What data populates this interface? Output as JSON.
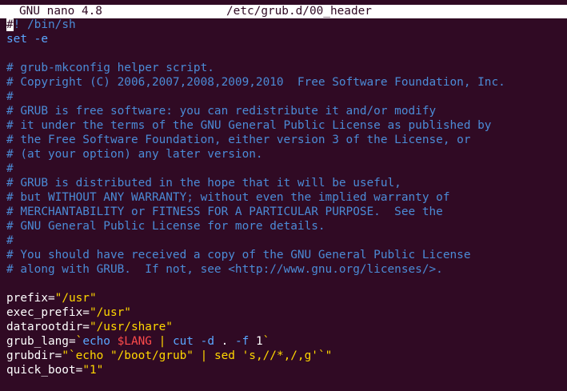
{
  "title_bar": {
    "app": "GNU nano 4.8",
    "file": "/etc/grub.d/00_header"
  },
  "editor": {
    "shebang_cursor": "#",
    "shebang_rest": "! /bin/sh",
    "set_cmd": "set -e",
    "comments": [
      "# grub-mkconfig helper script.",
      "# Copyright (C) 2006,2007,2008,2009,2010  Free Software Foundation, Inc.",
      "#",
      "# GRUB is free software: you can redistribute it and/or modify",
      "# it under the terms of the GNU General Public License as published by",
      "# the Free Software Foundation, either version 3 of the License, or",
      "# (at your option) any later version.",
      "#",
      "# GRUB is distributed in the hope that it will be useful,",
      "# but WITHOUT ANY WARRANTY; without even the implied warranty of",
      "# MERCHANTABILITY or FITNESS FOR A PARTICULAR PURPOSE.  See the",
      "# GNU General Public License for more details.",
      "#",
      "# You should have received a copy of the GNU General Public License",
      "# along with GRUB.  If not, see <http://www.gnu.org/licenses/>."
    ],
    "assignments": {
      "prefix": {
        "name": "prefix=",
        "value": "\"/usr\""
      },
      "exec_prefix": {
        "name": "exec_prefix=",
        "value": "\"/usr\""
      },
      "datarootdir": {
        "name": "datarootdir=",
        "value": "\"/usr/share\""
      },
      "grub_lang": {
        "name": "grub_lang=",
        "tick_open": "`",
        "echo": "echo",
        "lang_var": "$LANG",
        "pipe": "|",
        "cut": "cut",
        "opt_d": "-d",
        "dot": ".",
        "opt_f": "-f",
        "one": "1",
        "tick_close": "`"
      },
      "grubdir": {
        "name": "grubdir=",
        "q_open": "\"`",
        "echo": "echo",
        "path": "\"/boot/grub\"",
        "pipe": "|",
        "sed": "sed",
        "expr": "'s,//*,/,g'",
        "q_close": "`\""
      },
      "quick_boot": {
        "name": "quick_boot=",
        "value": "\"1\""
      }
    }
  },
  "colors": {
    "background": "#300a24",
    "comment": "#4b8bd6",
    "string": "#ffd700",
    "keyword": "#5aa7ff",
    "variable": "#ff4b4b",
    "text": "#ffffff"
  }
}
